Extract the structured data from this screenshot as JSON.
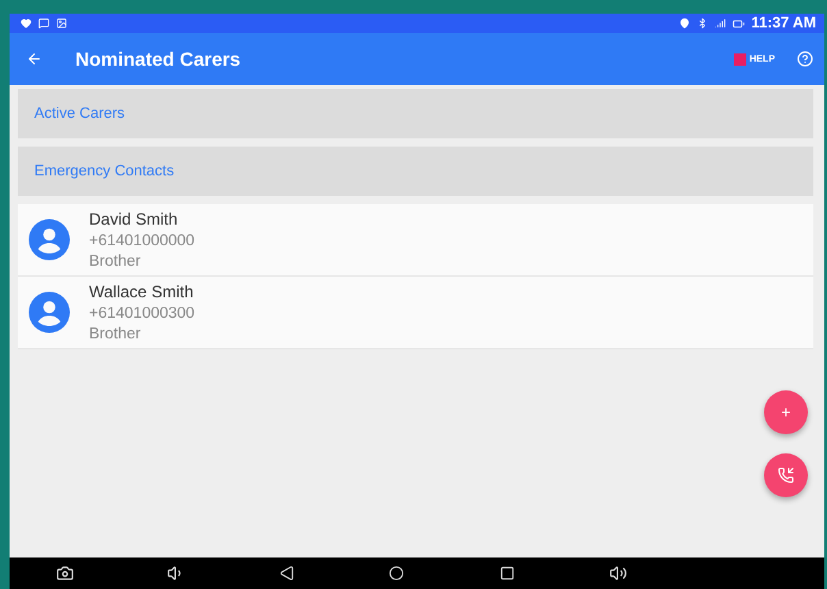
{
  "status_bar": {
    "time": "11:37 AM"
  },
  "app_bar": {
    "title": "Nominated Carers",
    "help_label": "HELP"
  },
  "sections": [
    "Active Carers",
    "Emergency Contacts"
  ],
  "contacts": [
    {
      "name": "David Smith",
      "phone": "+61401000000",
      "relation": "Brother"
    },
    {
      "name": "Wallace Smith",
      "phone": "+61401000300",
      "relation": "Brother"
    }
  ],
  "fabs": [
    {
      "kind": "text",
      "label": "+"
    },
    {
      "kind": "call"
    }
  ]
}
